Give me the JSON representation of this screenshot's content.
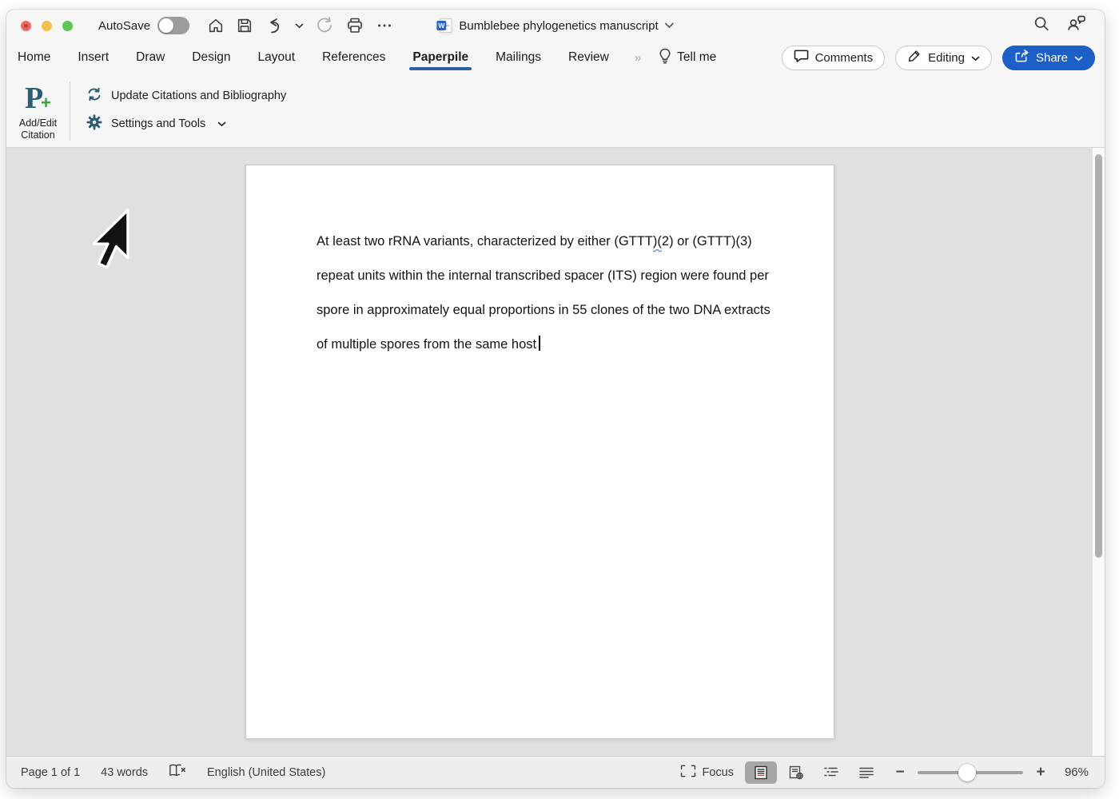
{
  "titlebar": {
    "autosave_label": "AutoSave",
    "doc_title": "Bumblebee phylogenetics manuscript"
  },
  "tabs": {
    "home": "Home",
    "insert": "Insert",
    "draw": "Draw",
    "design": "Design",
    "layout": "Layout",
    "references": "References",
    "paperpile": "Paperpile",
    "mailings": "Mailings",
    "review": "Review",
    "overflow": "»",
    "tellme": "Tell me"
  },
  "actions": {
    "comments": "Comments",
    "editing": "Editing",
    "share": "Share"
  },
  "ribbon": {
    "logo_letter": "P",
    "logo_plus": "+",
    "addedit_line1": "Add/Edit",
    "addedit_line2": "Citation",
    "update": "Update Citations and Bibliography",
    "settings": "Settings and Tools"
  },
  "document": {
    "line1_pre": "At least two rRNA variants, characterized by either (GTTT",
    "line1_squiggle": ")(",
    "line1_post": "2) or (GTTT)(3)",
    "line2": "repeat units within the internal transcribed spacer (ITS) region were found per",
    "line3": "spore in approximately equal proportions in 55 clones of the two DNA extracts",
    "line4": "of multiple spores from the same host"
  },
  "statusbar": {
    "page": "Page 1 of 1",
    "words": "43 words",
    "language": "English (United States)",
    "focus": "Focus",
    "zoom_percent": "96%",
    "zoom_value": 47
  },
  "colors": {
    "share_blue": "#1b5fc7",
    "tab_underline_blue": "#2e5fa5",
    "paperpile_teal": "#2b5d76",
    "paperpile_green": "#3aa33c",
    "squiggle_blue": "#3b6fd4",
    "traffic_red": "#ec6a5e",
    "traffic_yellow": "#f5bf4f",
    "traffic_green": "#5fc454"
  }
}
